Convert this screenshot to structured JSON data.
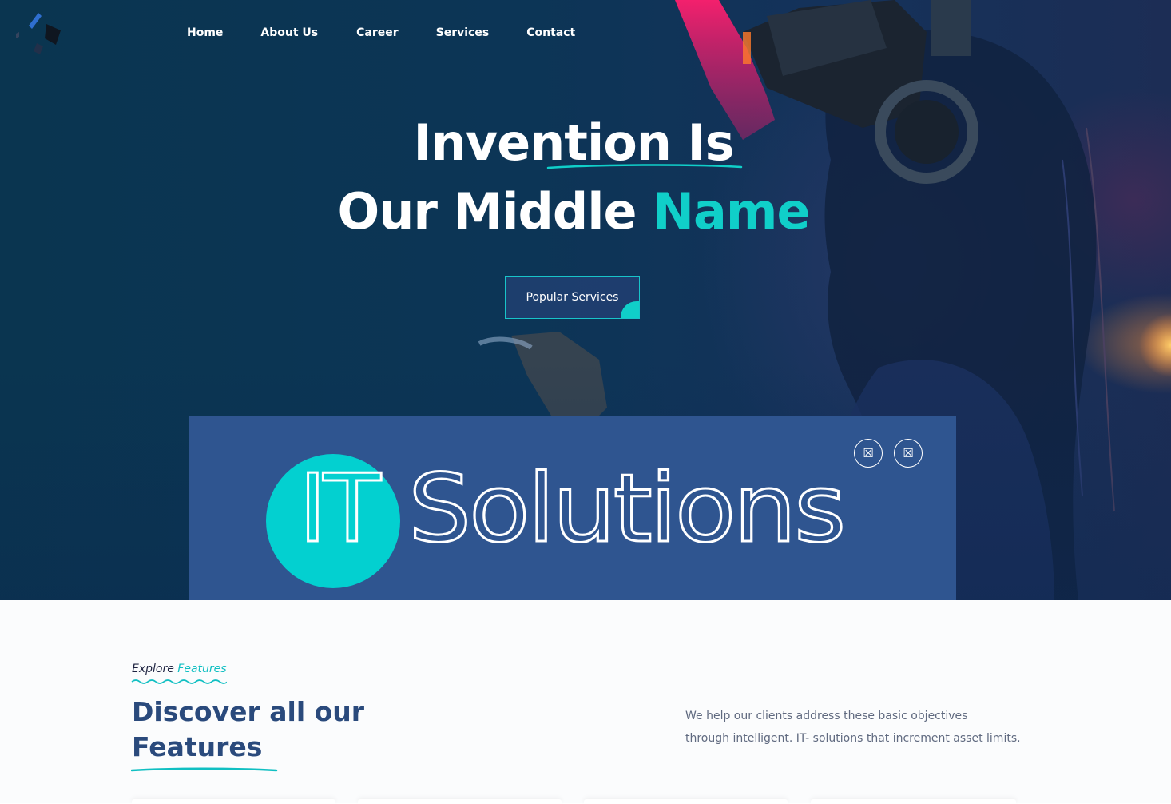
{
  "nav": {
    "items": [
      {
        "label": "Home"
      },
      {
        "label": "About Us"
      },
      {
        "label": "Career"
      },
      {
        "label": "Services"
      },
      {
        "label": "Contact"
      }
    ]
  },
  "hero": {
    "title_line1": "Invention Is",
    "title_line2_prefix": "Our Middle ",
    "title_line2_accent": "Name",
    "cta_label": "Popular Services"
  },
  "panel": {
    "logo_text_it": "IT",
    "logo_text_rest": "Solutions",
    "button_icon_1": "☒",
    "button_icon_2": "☒"
  },
  "features": {
    "eyebrow_prefix": "Explore ",
    "eyebrow_accent": "Features",
    "heading_line1": "Discover all our",
    "heading_line2": "Features",
    "text_line1": "We help our clients address these basic objectives",
    "text_line2": "through intelligent. IT- solutions that increment asset limits."
  },
  "colors": {
    "accent": "#10cfc9",
    "panel": "#2f5590",
    "heading": "#2a4a7c",
    "hero_bg": "#0c3556"
  }
}
